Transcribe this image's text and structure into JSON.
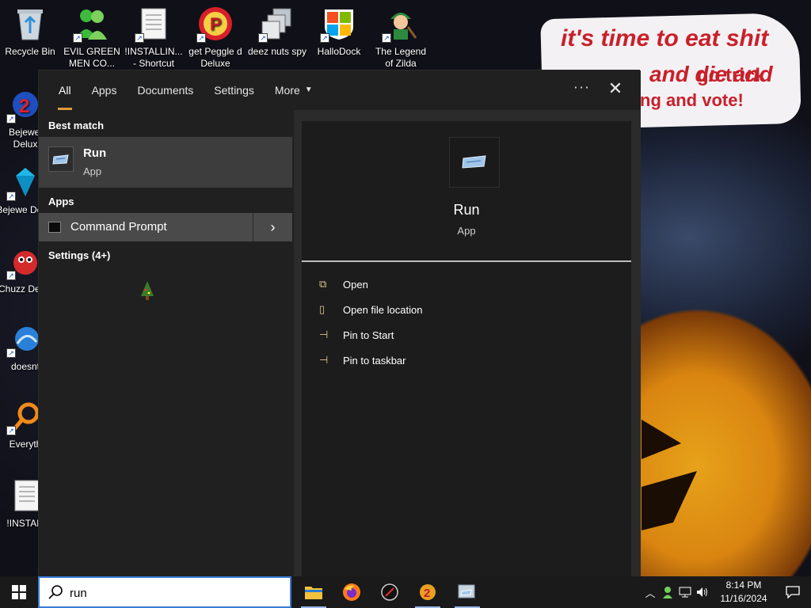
{
  "wallpaper": {
    "bubble_line_1": "it's time to eat shit",
    "bubble_line_2": "and die and",
    "bubble_line_2b": "go trick",
    "bubble_line_3": "ng and vote!"
  },
  "desktop_icons": [
    {
      "label": "Recycle Bin",
      "icon": "recycle-bin-icon"
    },
    {
      "label": "EVIL GREEN MEN CO...",
      "icon": "messenger-people-icon"
    },
    {
      "label": "!INSTALLIN... - Shortcut",
      "icon": "text-document-icon"
    },
    {
      "label": "get Peggle d Deluxe",
      "icon": "peggle-icon"
    },
    {
      "label": "deez nuts spy",
      "icon": "stacked-windows-icon"
    },
    {
      "label": "HalloDock",
      "icon": "windows-logo-icon"
    },
    {
      "label": "The Legend of Zilda",
      "icon": "zilda-character-icon"
    },
    {
      "label": "Bejewel Delux",
      "icon": "bejeweled-gem-icon"
    },
    {
      "label": "Bejewe Delux",
      "icon": "diamond-gem-icon"
    },
    {
      "label": "Chuzz Delux",
      "icon": "chuzzle-icon"
    },
    {
      "label": "doesnt",
      "icon": "blue-app-icon"
    },
    {
      "label": "Everyth",
      "icon": "everything-search-icon"
    },
    {
      "label": "!INSTALL",
      "icon": "text-document-icon"
    }
  ],
  "search_panel": {
    "tabs": [
      {
        "label": "All",
        "active": true
      },
      {
        "label": "Apps",
        "active": false
      },
      {
        "label": "Documents",
        "active": false
      },
      {
        "label": "Settings",
        "active": false
      },
      {
        "label": "More",
        "active": false
      }
    ],
    "ellipsis": "···",
    "close_symbol": "✕",
    "best_match_heading": "Best match",
    "best_match": {
      "name": "Run",
      "type": "App"
    },
    "apps_heading": "Apps",
    "apps": [
      {
        "name": "Command Prompt"
      }
    ],
    "settings_heading": "Settings (4+)",
    "preview": {
      "name": "Run",
      "type": "App",
      "actions": [
        {
          "label": "Open",
          "icon": "open-icon"
        },
        {
          "label": "Open file location",
          "icon": "file-location-icon"
        },
        {
          "label": "Pin to Start",
          "icon": "pin-icon"
        },
        {
          "label": "Pin to taskbar",
          "icon": "pin-icon"
        }
      ]
    }
  },
  "taskbar": {
    "search_value": "run",
    "apps": [
      {
        "name": "File Explorer",
        "icon": "folder-icon"
      },
      {
        "name": "Firefox",
        "icon": "firefox-icon"
      },
      {
        "name": "Compass",
        "icon": "compass-icon"
      },
      {
        "name": "Bejeweled",
        "icon": "bejeweled-gem-icon"
      },
      {
        "name": "Run",
        "icon": "run-icon"
      }
    ],
    "time": "8:14 PM",
    "date": "11/16/2024"
  },
  "colors": {
    "accent": "#e09a3a",
    "panel_bg": "#202020",
    "selected_bg": "#3d3d3d",
    "taskbar_bg": "#1a1a1a"
  }
}
